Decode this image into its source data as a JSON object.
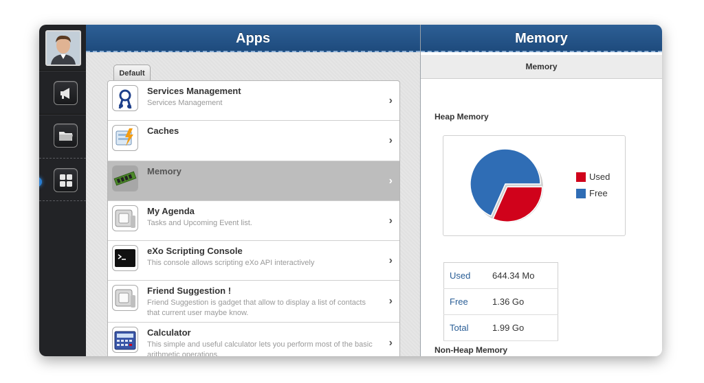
{
  "colors": {
    "header_blue": "#1e4b7d",
    "used": "#d0021b",
    "free": "#2f6db5",
    "link_blue": "#2a5e96"
  },
  "rail": {
    "items": [
      "avatar",
      "megaphone-icon",
      "folder-icon",
      "apps-grid-icon"
    ],
    "active": "apps-grid-icon"
  },
  "apps": {
    "title": "Apps",
    "tab": "Default",
    "items": [
      {
        "title": "Services Management",
        "desc": "Services Management",
        "icon": "services-icon"
      },
      {
        "title": "Caches",
        "desc": "",
        "icon": "caches-icon"
      },
      {
        "title": "Memory",
        "desc": "",
        "icon": "memory-icon",
        "selected": true
      },
      {
        "title": "My Agenda",
        "desc": "Tasks and Upcoming Event list.",
        "icon": "agenda-icon"
      },
      {
        "title": "eXo Scripting Console",
        "desc": "This console allows scripting eXo API interactively",
        "icon": "console-icon"
      },
      {
        "title": "Friend Suggestion !",
        "desc": "Friend Suggestion is gadget that allow to display a list of contacts that current user maybe know.",
        "icon": "friend-icon"
      },
      {
        "title": "Calculator",
        "desc": "This simple and useful calculator lets you perform most of the basic arithmetic operations.",
        "icon": "calculator-icon"
      }
    ]
  },
  "memory": {
    "title": "Memory",
    "subtitle": "Memory",
    "heap_label": "Heap Memory",
    "nonheap_label": "Non-Heap Memory",
    "legend": {
      "used": "Used",
      "free": "Free"
    },
    "table": [
      {
        "key": "Used",
        "value": "644.34 Mo"
      },
      {
        "key": "Free",
        "value": "1.36 Go"
      },
      {
        "key": "Total",
        "value": "1.99 Go"
      }
    ]
  },
  "chart_data": {
    "type": "pie",
    "categories": [
      "Used",
      "Free"
    ],
    "values": [
      644.34,
      1392.6
    ],
    "colors": [
      "#d0021b",
      "#2f6db5"
    ],
    "legend": "right"
  }
}
